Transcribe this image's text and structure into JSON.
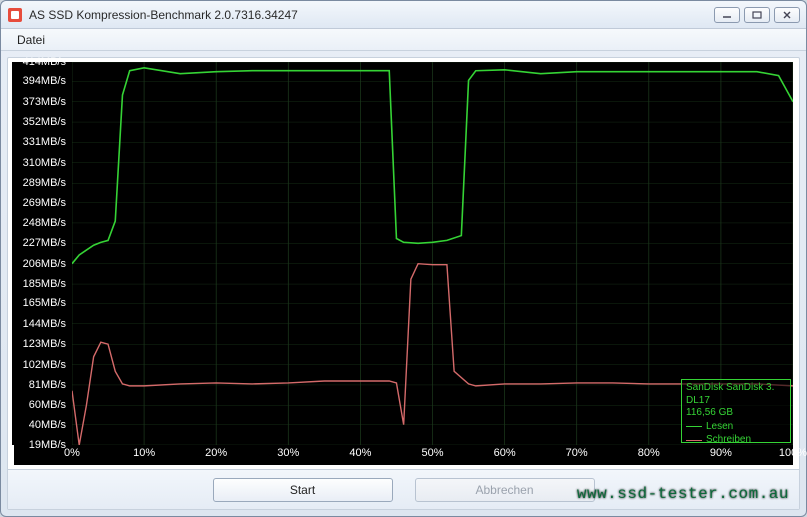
{
  "window": {
    "title": "AS SSD Kompression-Benchmark 2.0.7316.34247"
  },
  "menubar": {
    "file": "Datei"
  },
  "buttons": {
    "start": "Start",
    "cancel": "Abbrechen"
  },
  "legend": {
    "device": "SanDisk SanDisk 3.",
    "firmware": "DL17",
    "capacity": "116,56 GB",
    "read": "Lesen",
    "write": "Schreiben",
    "read_color": "#35d335",
    "write_color": "#d46a6a"
  },
  "watermark": "www.ssd-tester.com.au",
  "chart_data": {
    "type": "line",
    "xlabel": "",
    "ylabel": "",
    "xlim": [
      0,
      100
    ],
    "ylim": [
      19,
      414
    ],
    "x_ticks": [
      "0%",
      "10%",
      "20%",
      "30%",
      "40%",
      "50%",
      "60%",
      "70%",
      "80%",
      "90%",
      "100%"
    ],
    "y_ticks": [
      "414MB/s",
      "394MB/s",
      "373MB/s",
      "352MB/s",
      "331MB/s",
      "310MB/s",
      "289MB/s",
      "269MB/s",
      "248MB/s",
      "227MB/s",
      "206MB/s",
      "185MB/s",
      "165MB/s",
      "144MB/s",
      "123MB/s",
      "102MB/s",
      "81MB/s",
      "60MB/s",
      "40MB/s",
      "19MB/s"
    ],
    "series": [
      {
        "name": "Lesen",
        "color": "#35d335",
        "x": [
          0,
          1,
          2,
          3,
          4,
          5,
          6,
          7,
          8,
          10,
          15,
          20,
          25,
          30,
          35,
          40,
          44,
          45,
          46,
          48,
          50,
          52,
          54,
          55,
          56,
          60,
          65,
          70,
          75,
          80,
          85,
          90,
          95,
          98,
          100
        ],
        "values": [
          206,
          215,
          220,
          225,
          228,
          230,
          250,
          380,
          405,
          408,
          402,
          404,
          405,
          405,
          405,
          405,
          405,
          232,
          228,
          227,
          228,
          230,
          235,
          395,
          405,
          406,
          402,
          404,
          404,
          404,
          404,
          404,
          404,
          400,
          373
        ]
      },
      {
        "name": "Schreiben",
        "color": "#d46a6a",
        "x": [
          0,
          1,
          2,
          3,
          4,
          5,
          6,
          7,
          8,
          10,
          15,
          20,
          25,
          30,
          35,
          40,
          44,
          45,
          46,
          47,
          48,
          50,
          52,
          53,
          55,
          56,
          60,
          65,
          70,
          75,
          80,
          85,
          90,
          95,
          100
        ],
        "values": [
          75,
          19,
          60,
          110,
          125,
          123,
          95,
          82,
          80,
          80,
          82,
          83,
          82,
          83,
          85,
          85,
          85,
          83,
          40,
          190,
          206,
          205,
          205,
          95,
          82,
          80,
          82,
          82,
          83,
          83,
          82,
          82,
          82,
          82,
          80
        ]
      }
    ]
  }
}
